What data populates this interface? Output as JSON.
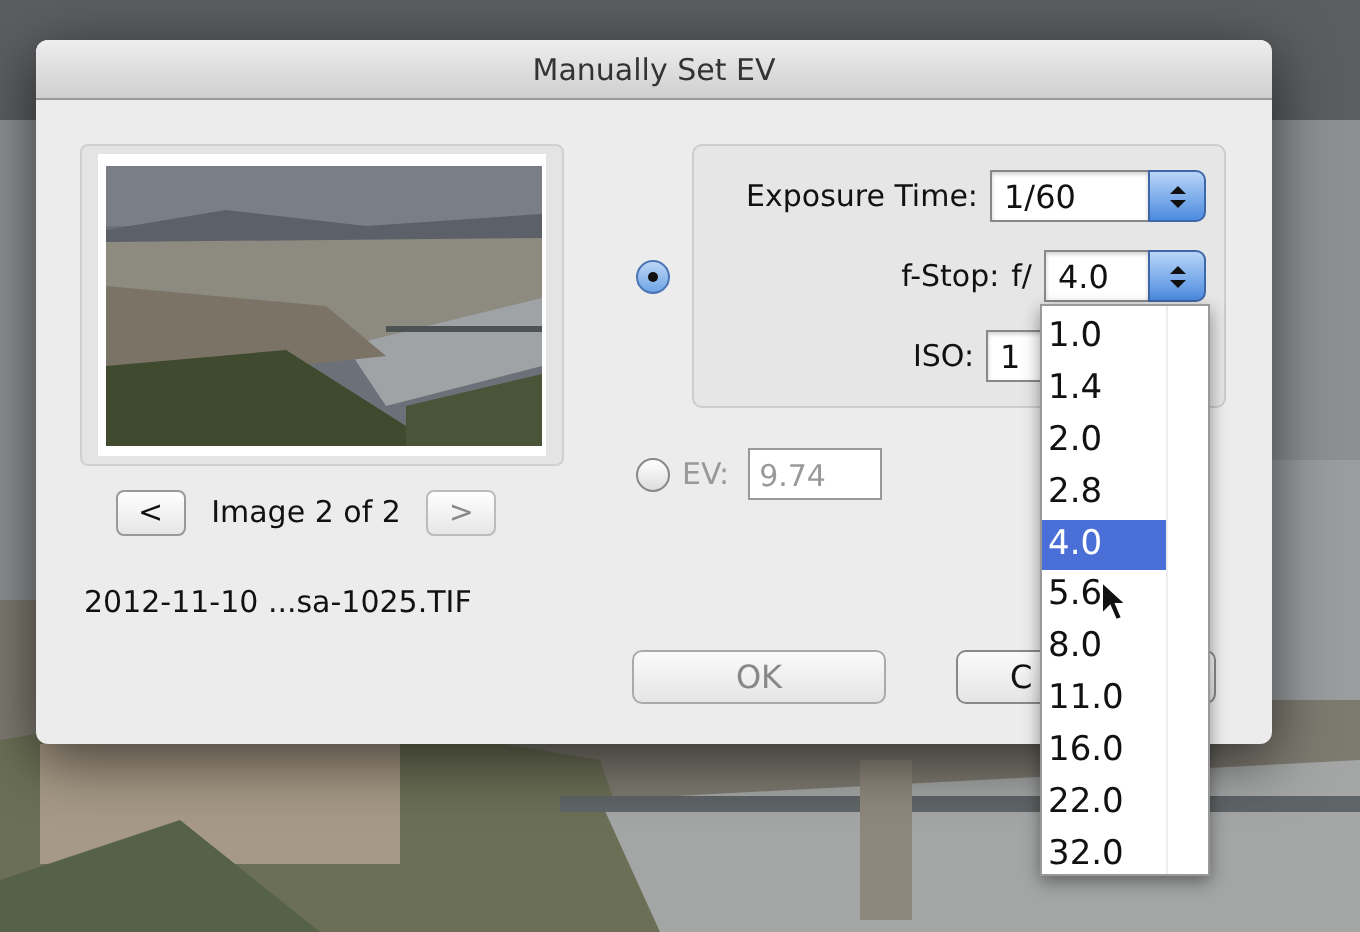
{
  "window": {
    "title": "Manually Set EV"
  },
  "preview": {
    "kind": "picture",
    "prev_button": "<",
    "caption": "Image 2 of 2",
    "next_button": ">",
    "next_disabled": true,
    "filename": "2012-11-10 ...sa-1025.TIF"
  },
  "modes": [
    {
      "kind": "manual",
      "selected": true,
      "fields": [
        {
          "label": "Exposure Time:",
          "value": "1/60"
        },
        {
          "label": "f-Stop:",
          "prefix": "f/",
          "value": "4.0"
        },
        {
          "label": "ISO:",
          "value": "1"
        }
      ]
    },
    {
      "kind": "ev",
      "selected": false,
      "label": "EV:",
      "value": "9.74"
    }
  ],
  "buttons": [
    {
      "label": "OK",
      "disabled": true
    },
    {
      "label": "C",
      "disabled": false
    }
  ],
  "fstop_menu": {
    "items": [
      {
        "label": "1.0",
        "selected": false
      },
      {
        "label": "1.4",
        "selected": false
      },
      {
        "label": "2.0",
        "selected": false
      },
      {
        "label": "2.8",
        "selected": false
      },
      {
        "label": "4.0",
        "selected": true
      },
      {
        "label": "5.6",
        "selected": false
      },
      {
        "label": "8.0",
        "selected": false
      },
      {
        "label": "11.0",
        "selected": false
      },
      {
        "label": "16.0",
        "selected": false
      },
      {
        "label": "22.0",
        "selected": false
      },
      {
        "label": "32.0",
        "selected": false
      }
    ]
  }
}
